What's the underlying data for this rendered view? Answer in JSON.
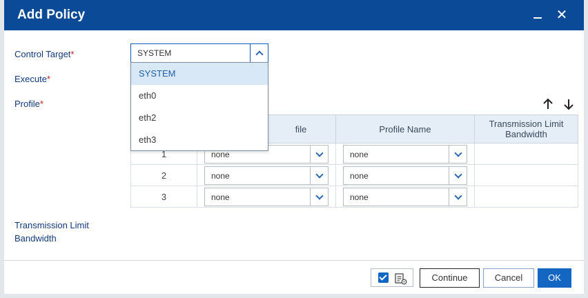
{
  "dialog": {
    "title": "Add Policy"
  },
  "form": {
    "control_target_label": "Control Target",
    "execute_label": "Execute",
    "profile_label": "Profile",
    "bandwidth_label_line1": "Transmission Limit",
    "bandwidth_label_line2": "Bandwidth",
    "required_mark": "*"
  },
  "control_target": {
    "value": "SYSTEM",
    "options": [
      "SYSTEM",
      "eth0",
      "eth2",
      "eth3"
    ],
    "selected_index": 0
  },
  "profile_table": {
    "headers": [
      "",
      "Profile",
      "Profile Name",
      "Transmission Limit Bandwidth"
    ],
    "header_visible_profile": "file",
    "rows": [
      {
        "num": "1",
        "profile": "none",
        "profile_name": "none",
        "bandwidth": ""
      },
      {
        "num": "2",
        "profile": "none",
        "profile_name": "none",
        "bandwidth": ""
      },
      {
        "num": "3",
        "profile": "none",
        "profile_name": "none",
        "bandwidth": ""
      }
    ]
  },
  "footer": {
    "continue_label": "Continue",
    "cancel_label": "Cancel",
    "ok_label": "OK"
  },
  "icons": {
    "minimize": "minimize-icon",
    "close": "close-icon",
    "move_up": "arrow-up-icon",
    "move_down": "arrow-down-icon",
    "checkbox": "checkbox-icon",
    "settings": "list-settings-icon"
  },
  "colors": {
    "titlebar": "#0b4a97",
    "accent": "#1366c2",
    "required": "#d0161b"
  }
}
